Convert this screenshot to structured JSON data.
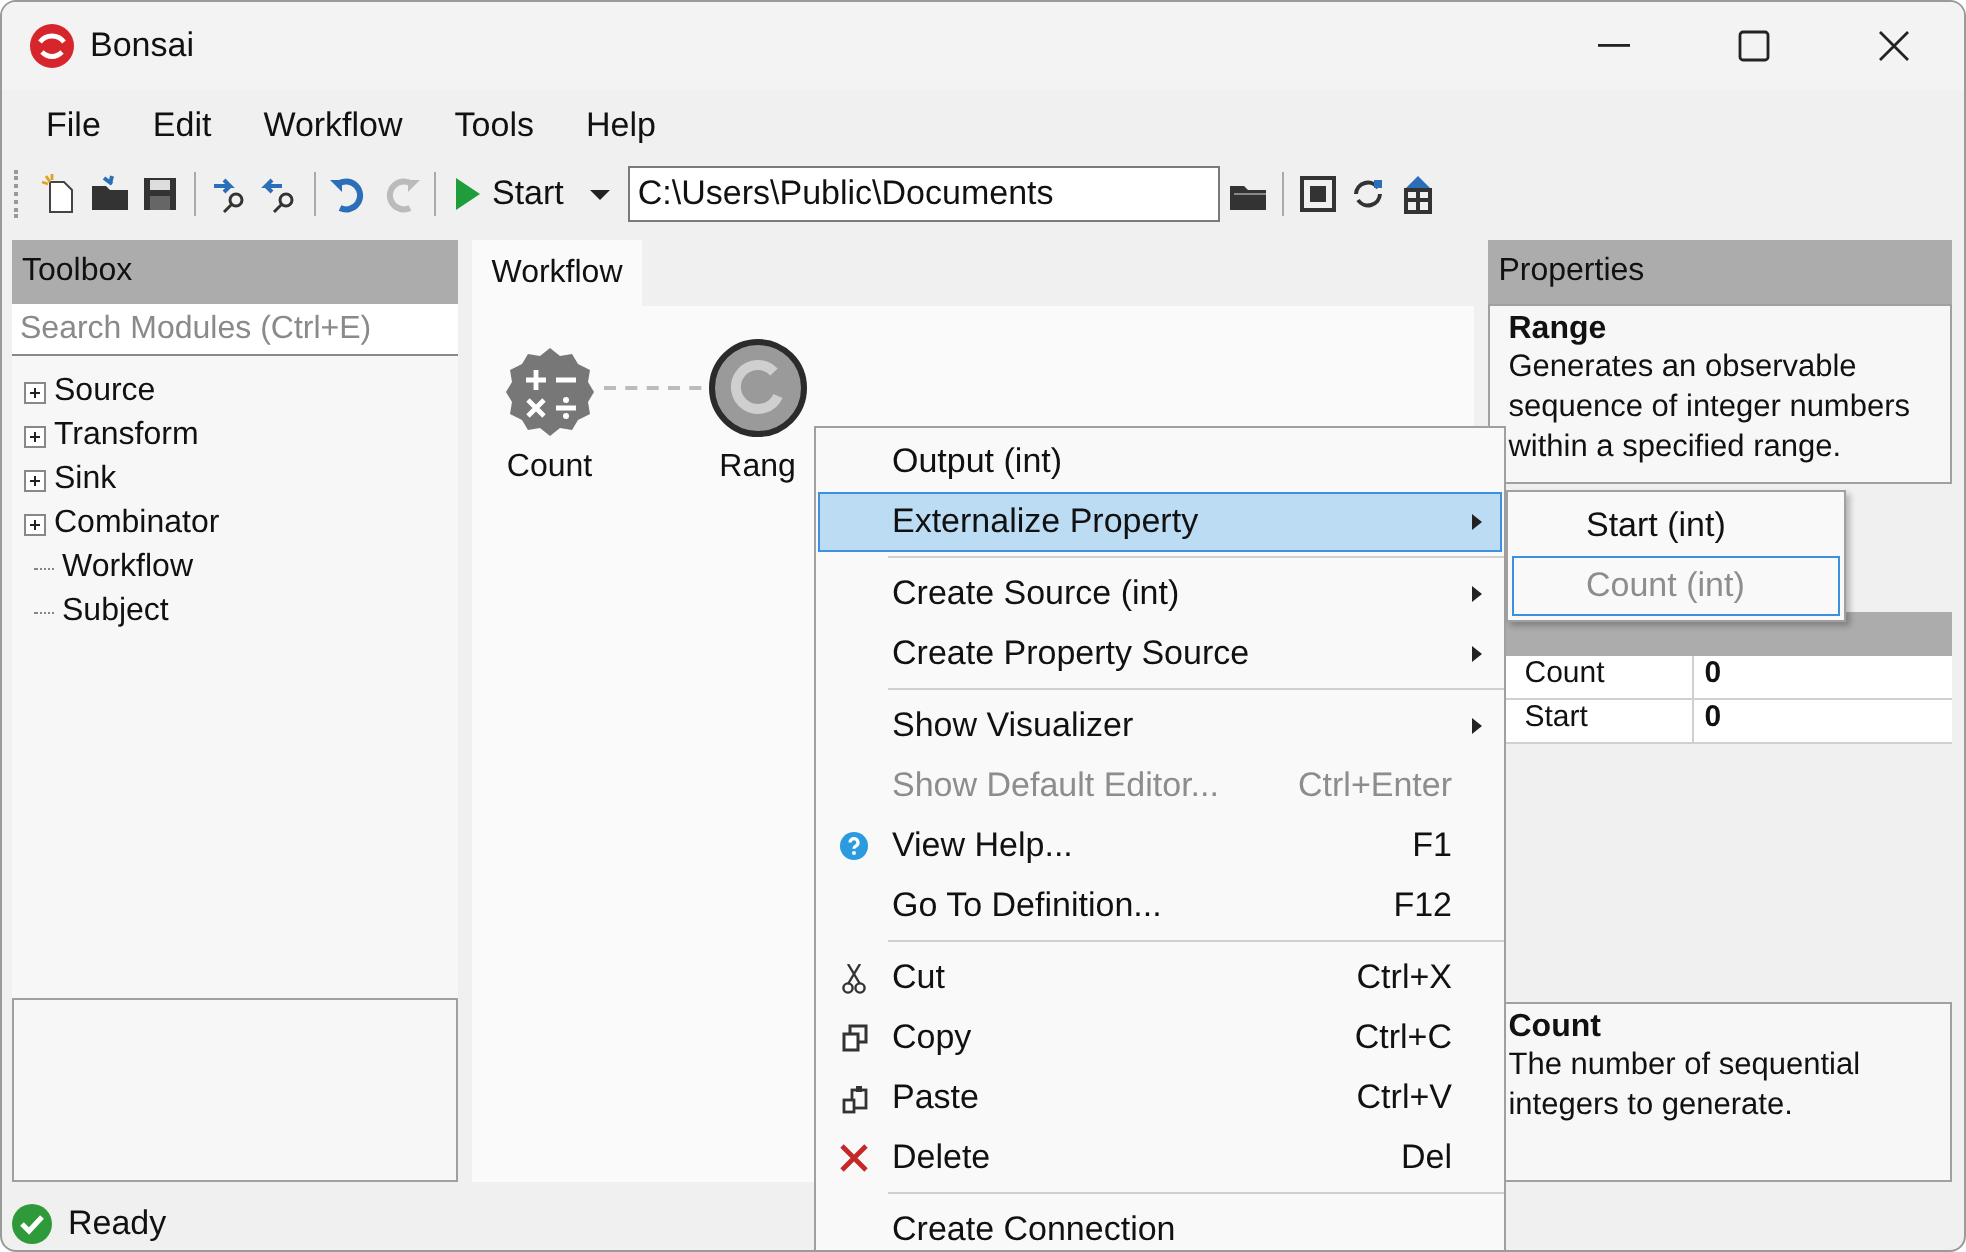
{
  "window": {
    "title": "Bonsai"
  },
  "menu_bar": [
    "File",
    "Edit",
    "Workflow",
    "Tools",
    "Help"
  ],
  "toolbar": {
    "start_button": "Start",
    "path": "C:\\Users\\Public\\Documents"
  },
  "toolbox": {
    "title": "Toolbox",
    "search": {
      "placeholder": "Search Modules (Ctrl+E)"
    },
    "tree": [
      {
        "label": "Source",
        "kind": "group",
        "expanded": false
      },
      {
        "label": "Transform",
        "kind": "group",
        "expanded": false
      },
      {
        "label": "Sink",
        "kind": "group",
        "expanded": false
      },
      {
        "label": "Combinator",
        "kind": "group",
        "expanded": false
      },
      {
        "label": "Workflow",
        "kind": "leaf"
      },
      {
        "label": "Subject",
        "kind": "leaf"
      }
    ]
  },
  "workflow": {
    "tab": "Workflow",
    "nodes": [
      {
        "label": "Count",
        "kind": "operator"
      },
      {
        "label": "Rang",
        "kind": "source"
      }
    ]
  },
  "context_menu": [
    {
      "kind": "item",
      "label": "Output (int)",
      "selected": false,
      "disabled": false
    },
    {
      "kind": "item",
      "label": "Externalize Property",
      "selected": true,
      "disabled": false,
      "submenu": true
    },
    {
      "kind": "separator"
    },
    {
      "kind": "item",
      "label": "Create Source (int)",
      "selected": false,
      "disabled": false,
      "submenu": true
    },
    {
      "kind": "item",
      "label": "Create Property Source",
      "selected": false,
      "disabled": false,
      "submenu": true
    },
    {
      "kind": "separator"
    },
    {
      "kind": "item",
      "label": "Show Visualizer",
      "selected": false,
      "disabled": false,
      "submenu": true
    },
    {
      "kind": "item",
      "label": "Show Default Editor...",
      "shortcut": "Ctrl+Enter",
      "selected": false,
      "disabled": true
    },
    {
      "kind": "item",
      "label": "View Help...",
      "shortcut": "F1",
      "selected": false,
      "disabled": false
    },
    {
      "kind": "item",
      "label": "Go To Definition...",
      "shortcut": "F12",
      "selected": false,
      "disabled": false
    },
    {
      "kind": "separator"
    },
    {
      "kind": "item",
      "label": "Cut",
      "shortcut": "Ctrl+X",
      "selected": false,
      "disabled": false
    },
    {
      "kind": "item",
      "label": "Copy",
      "shortcut": "Ctrl+C",
      "selected": false,
      "disabled": false
    },
    {
      "kind": "item",
      "label": "Paste",
      "shortcut": "Ctrl+V",
      "selected": false,
      "disabled": false
    },
    {
      "kind": "item",
      "label": "Delete",
      "shortcut": "Del",
      "selected": false,
      "disabled": false
    },
    {
      "kind": "separator"
    },
    {
      "kind": "item",
      "label": "Create Connection",
      "selected": false,
      "disabled": false
    }
  ],
  "submenu": [
    {
      "label": "Start (int)",
      "selected": false,
      "disabled": false
    },
    {
      "label": "Count (int)",
      "selected": true,
      "disabled": true
    }
  ],
  "properties": {
    "title": "Properties",
    "name": "Range",
    "description": "Generates an observable sequence of integer numbers within a specified range.",
    "rows": [
      {
        "name": "Count",
        "value": "0"
      },
      {
        "name": "Start",
        "value": "0"
      }
    ],
    "help_title": "Count",
    "help_text": "The number of sequential integers to generate."
  },
  "status_bar": {
    "text": "Ready"
  }
}
